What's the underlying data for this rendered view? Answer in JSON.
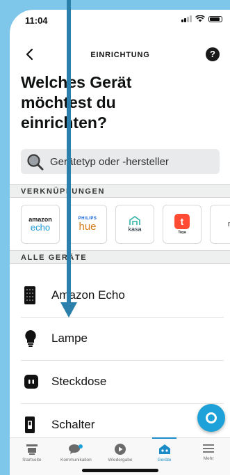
{
  "status": {
    "time": "11:04"
  },
  "header": {
    "title": "EINRICHTUNG",
    "help": "?"
  },
  "page_title": "Welches Gerät möchtest du einrichten?",
  "search": {
    "placeholder": "Gerätetyp oder -hersteller"
  },
  "sections": {
    "links": "VERKNÜPFUNGEN",
    "all_devices": "ALLE GERÄTE"
  },
  "brands": [
    {
      "name": "amazon echo",
      "top": "amazon",
      "bottom": "echo"
    },
    {
      "name": "philips hue",
      "top": "PHILIPS",
      "bottom": "hue"
    },
    {
      "name": "kasa",
      "bottom": "kasa"
    },
    {
      "name": "Tuya",
      "bottom": "Tuya"
    },
    {
      "name": "partial",
      "bottom": "m"
    }
  ],
  "devices": [
    {
      "label": "Amazon Echo",
      "icon": "echo-speaker-icon"
    },
    {
      "label": "Lampe",
      "icon": "bulb-icon"
    },
    {
      "label": "Steckdose",
      "icon": "plug-icon"
    },
    {
      "label": "Schalter",
      "icon": "switch-icon"
    }
  ],
  "tabs": [
    {
      "label": "Startseite",
      "icon": "home-icon"
    },
    {
      "label": "Kommunikation",
      "icon": "chat-icon"
    },
    {
      "label": "Wiedergabe",
      "icon": "play-icon"
    },
    {
      "label": "Geräte",
      "icon": "devices-icon",
      "active": true
    },
    {
      "label": "Mehr",
      "icon": "menu-icon"
    }
  ],
  "colors": {
    "accent": "#1b8cc8",
    "arrow": "#2b7fab",
    "background": "#7ec7ea"
  }
}
